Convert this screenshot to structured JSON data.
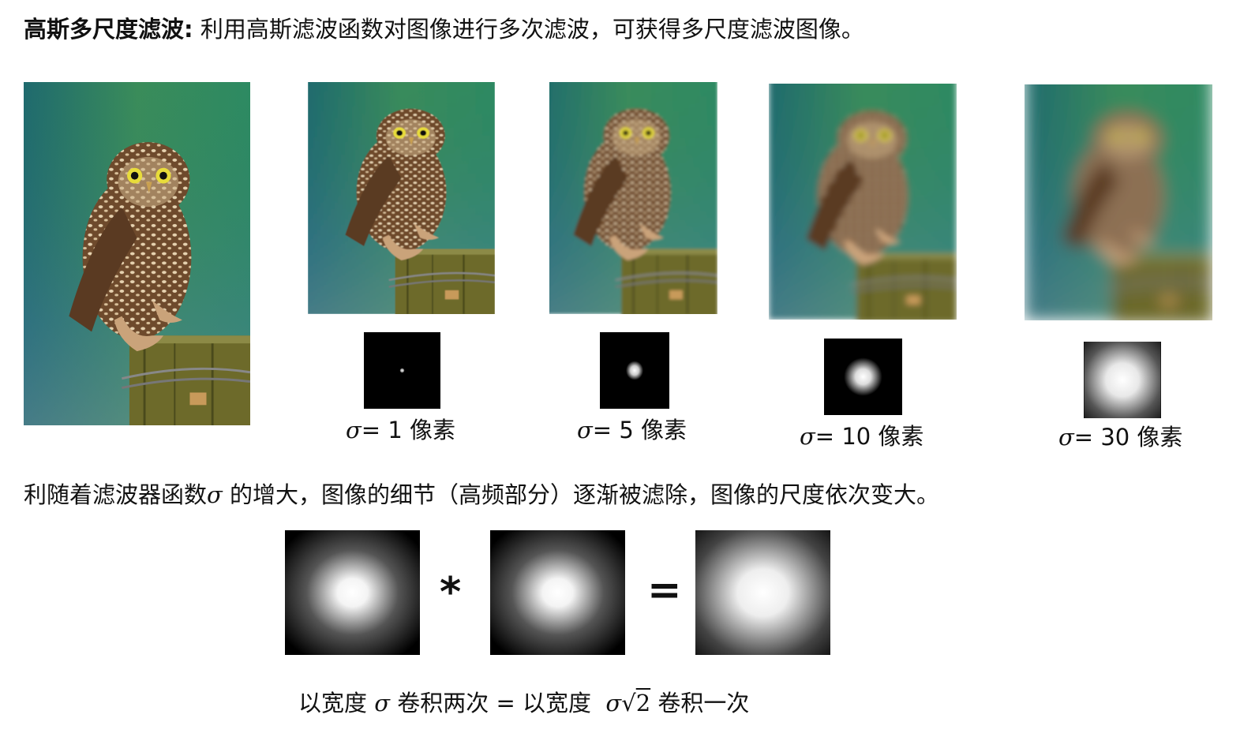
{
  "heading": {
    "bold": "高斯多尺度滤波:",
    "rest": " 利用高斯滤波函数对图像进行多次滤波，可获得多尺度滤波图像。"
  },
  "filters": [
    {
      "symbol": "σ",
      "eq": "= 1 像素",
      "sigma": 1
    },
    {
      "symbol": "σ",
      "eq": "= 5 像素",
      "sigma": 5
    },
    {
      "symbol": "σ",
      "eq": "= 10 像素",
      "sigma": 10
    },
    {
      "symbol": "σ",
      "eq": "= 30 像素",
      "sigma": 30
    }
  ],
  "paragraph": {
    "before": "利随着滤波器函数",
    "symbol": "σ",
    "after": " 的增大，图像的细节（高频部分）逐渐被滤除，图像的尺度依次变大。"
  },
  "equation": {
    "convolve": "*",
    "equals": "="
  },
  "formula": {
    "part1": "以宽度 ",
    "sigma": "σ",
    "part2": " 卷积两次 = 以宽度 ",
    "sigma2": "σ",
    "sqrt": "√",
    "two": "2",
    "part3": " 卷积一次"
  },
  "colors": {
    "text": "#111111",
    "kernel_bg": "#000000",
    "background_green": "#2f8a5a",
    "owl_brown": "#7a5230"
  }
}
